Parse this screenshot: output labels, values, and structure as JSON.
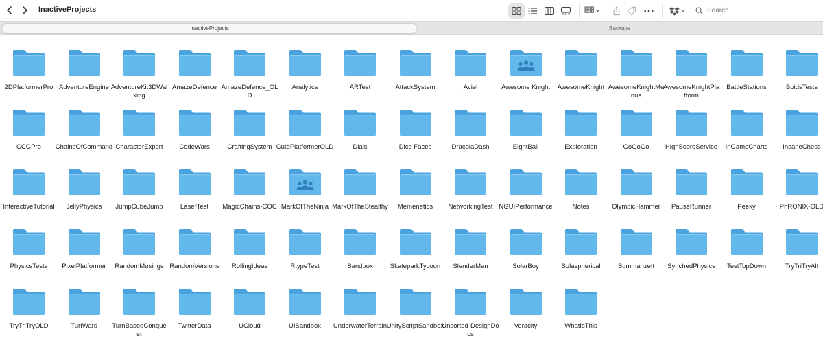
{
  "window": {
    "title": "InactiveProjects"
  },
  "toolbar": {
    "back_icon": "chevron-left-icon",
    "forward_icon": "chevron-right-icon",
    "views": [
      "icon-view",
      "list-view",
      "column-view",
      "gallery-view"
    ],
    "active_view": "icon-view",
    "search_placeholder": "Search"
  },
  "tabs": [
    {
      "label": "InactiveProjects",
      "active": true
    },
    {
      "label": "Backups",
      "active": false
    }
  ],
  "colors": {
    "folder_front": "#62b8eb",
    "folder_back": "#4aa3df",
    "shared_badge": "#2f7fbd"
  },
  "folders": [
    {
      "name": "2DPlatformerPro"
    },
    {
      "name": "AdventureEngine"
    },
    {
      "name": "AdventureKit3DWalking"
    },
    {
      "name": "AmazeDefence"
    },
    {
      "name": "AmazeDefence_OLD"
    },
    {
      "name": "Analytics"
    },
    {
      "name": "ARTest"
    },
    {
      "name": "AttackSystem"
    },
    {
      "name": "Aviel"
    },
    {
      "name": "Awesome Knight",
      "shared": true
    },
    {
      "name": "AwesomeKnight"
    },
    {
      "name": "AwesomeKnightMenus"
    },
    {
      "name": "AwesomeKnightPlatform"
    },
    {
      "name": "BattleStations"
    },
    {
      "name": "BoidsTests"
    },
    {
      "name": "CCGPro"
    },
    {
      "name": "ChainsOfCommand"
    },
    {
      "name": "CharacterExport"
    },
    {
      "name": "CodeWars"
    },
    {
      "name": "CraftingSystem"
    },
    {
      "name": "CutePlatformerOLD"
    },
    {
      "name": "Dials"
    },
    {
      "name": "Dice Faces"
    },
    {
      "name": "DracolaDash"
    },
    {
      "name": "EightBall"
    },
    {
      "name": "Exploration"
    },
    {
      "name": "GoGoGo"
    },
    {
      "name": "HighScoreService"
    },
    {
      "name": "InGameCharts"
    },
    {
      "name": "InsaneChess"
    },
    {
      "name": "InteractiveTutorial"
    },
    {
      "name": "JellyPhysics"
    },
    {
      "name": "JumpCubeJump"
    },
    {
      "name": "LaserTest"
    },
    {
      "name": "MagicChains-COC"
    },
    {
      "name": "MarkOfTheNinja",
      "shared": true
    },
    {
      "name": "MarkOfTheStealthy"
    },
    {
      "name": "Memenetics"
    },
    {
      "name": "NetworkingTest"
    },
    {
      "name": "NGUIPerformance"
    },
    {
      "name": "Notes"
    },
    {
      "name": "OlympicHammer"
    },
    {
      "name": "PauseRunner"
    },
    {
      "name": "Peeky"
    },
    {
      "name": "PhRONIX-OLD"
    },
    {
      "name": "PhysicsTests"
    },
    {
      "name": "PixelPlatformer"
    },
    {
      "name": "RandomMusings"
    },
    {
      "name": "RandomVersions"
    },
    {
      "name": "RollingIdeas"
    },
    {
      "name": "RtypeTest"
    },
    {
      "name": "Sandbox"
    },
    {
      "name": "SkateparkTycoon"
    },
    {
      "name": "SlenderMan"
    },
    {
      "name": "SolarBoy"
    },
    {
      "name": "Solaspherical"
    },
    {
      "name": "SummarizeIt"
    },
    {
      "name": "SynchedPhysics"
    },
    {
      "name": "TestTopDown"
    },
    {
      "name": "TryTriTryAlt"
    },
    {
      "name": "TryTriTryOLD"
    },
    {
      "name": "TurfWars"
    },
    {
      "name": "TurnBasedConquest"
    },
    {
      "name": "TwitterData"
    },
    {
      "name": "UCloud"
    },
    {
      "name": "UISandbox"
    },
    {
      "name": "UnderwaterTerrain"
    },
    {
      "name": "UnityScriptSandbox"
    },
    {
      "name": "Unsorted-DesignDocs"
    },
    {
      "name": "Veracity"
    },
    {
      "name": "WhatIsThis"
    }
  ]
}
